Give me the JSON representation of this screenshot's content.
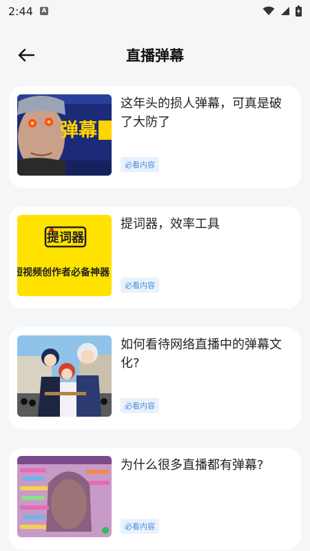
{
  "status_bar": {
    "time": "2:44",
    "notification_icon": "A"
  },
  "header": {
    "title": "直播弹幕"
  },
  "thumb_text": {
    "thumb1": "弹幕",
    "thumb2_logo": "提词器",
    "thumb2_caption": "短视频创作者必备神器"
  },
  "cards": [
    {
      "title": "这年头的损人弹幕，可真是破了大防了",
      "tag": "必看内容"
    },
    {
      "title": "提词器，效率工具",
      "tag": "必看内容"
    },
    {
      "title": "如何看待网络直播中的弹幕文化?",
      "tag": "必看内容"
    },
    {
      "title": "为什么很多直播都有弹幕?",
      "tag": "必看内容"
    }
  ]
}
